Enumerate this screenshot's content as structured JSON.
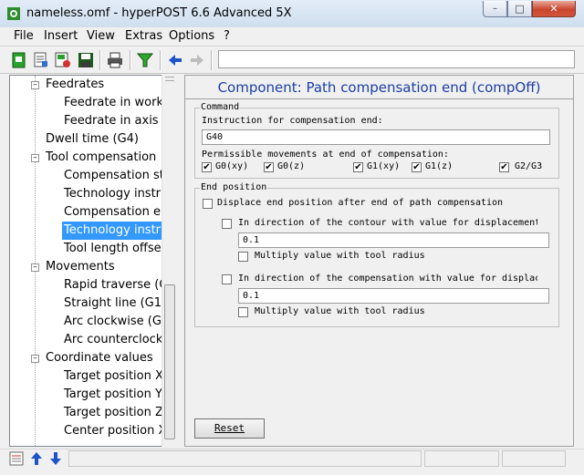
{
  "window": {
    "title": "nameless.omf - hyperPOST 6.6 Advanced 5X",
    "minimize_glyph": "–",
    "maximize_glyph": "□",
    "close_glyph": "✕"
  },
  "menu": [
    "File",
    "Insert",
    "View",
    "Extras",
    "Options",
    "?"
  ],
  "toolbar": {
    "icons": [
      "new-icon",
      "open-icon",
      "save-as-icon",
      "save-icon",
      "print-icon",
      "filter-icon",
      "back-arrow-icon",
      "forward-arrow-icon"
    ]
  },
  "tree": {
    "rows": [
      {
        "label": "Feedrates",
        "level": 1,
        "expander": "–"
      },
      {
        "label": "Feedrate in workpl",
        "level": 2
      },
      {
        "label": "Feedrate in axis di",
        "level": 2
      },
      {
        "label": "Dwell time (G4)",
        "level": 1
      },
      {
        "label": "Tool compensation",
        "level": 1,
        "expander": "–"
      },
      {
        "label": "Compensation star",
        "level": 2
      },
      {
        "label": "Technology instruc",
        "level": 2
      },
      {
        "label": "Compensation end",
        "level": 2
      },
      {
        "label": "Technology instruc",
        "level": 2,
        "selected": true
      },
      {
        "label": "Tool length offset",
        "level": 2
      },
      {
        "label": "Movements",
        "level": 1,
        "expander": "–"
      },
      {
        "label": "Rapid traverse (G0",
        "level": 2
      },
      {
        "label": "Straight line (G1)",
        "level": 2
      },
      {
        "label": "Arc clockwise (G2)",
        "level": 2
      },
      {
        "label": "Arc counterclockwi",
        "level": 2
      },
      {
        "label": "Coordinate values",
        "level": 1,
        "expander": "–"
      },
      {
        "label": "Target position X (",
        "level": 2
      },
      {
        "label": "Target position Y (",
        "level": 2
      },
      {
        "label": "Target position Z (",
        "level": 2
      },
      {
        "label": "Center position X (",
        "level": 2
      }
    ]
  },
  "panel": {
    "title": "Component: Path compensation end (compOff)",
    "command": {
      "group_title": "Command",
      "instruction_label": "Instruction for compensation end:",
      "instruction_value": "G40",
      "movements_label": "Permissible movements at end of compensation:",
      "movements": [
        {
          "label": "G0(xy)",
          "checked": true
        },
        {
          "label": "G0(z)",
          "checked": true
        },
        {
          "label": "G1(xy)",
          "checked": true
        },
        {
          "label": "G1(z)",
          "checked": true
        },
        {
          "label": "G2/G3",
          "checked": true
        }
      ]
    },
    "end_position": {
      "group_title": "End position",
      "displace_label": "Displace end position after end of path compensation",
      "contour_label": "In direction of the contour with value for displacement",
      "contour_value": "0.1",
      "contour_multiply_label": "Multiply value with tool radius",
      "comp_label": "In direction of the compensation with value for displac",
      "comp_value": "0.1",
      "comp_multiply_label": "Multiply value with tool radius"
    },
    "reset_label": "Reset"
  },
  "colors": {
    "title_accent": "#1a3ea8",
    "selection": "#3399ff"
  }
}
